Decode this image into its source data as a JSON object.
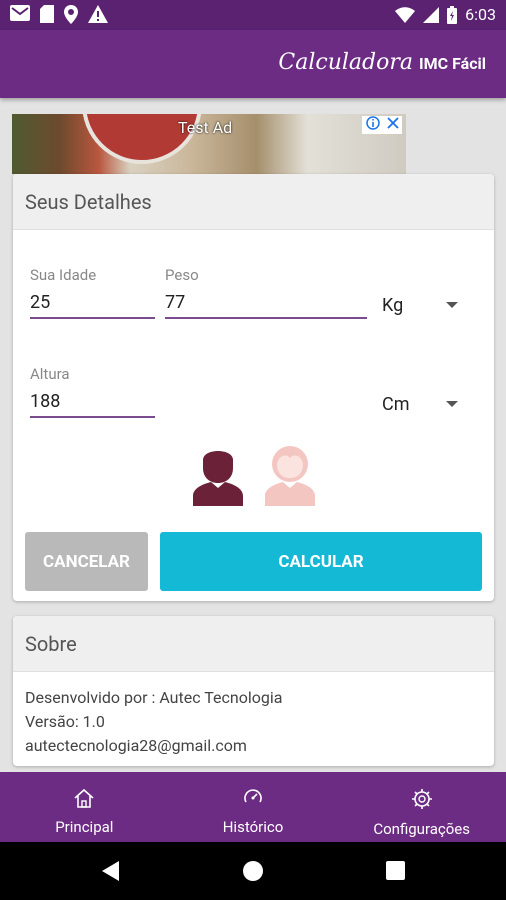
{
  "status_bar": {
    "time": "6:03",
    "left_icons": [
      "gmail-icon",
      "sd-card-icon",
      "location-icon",
      "warning-icon"
    ],
    "right_icons": [
      "wifi-icon",
      "signal-icon",
      "battery-icon"
    ]
  },
  "app_bar": {
    "title_script": "Calculadora",
    "title_plain": "IMC Fácil",
    "background": "#6c2c84"
  },
  "ad": {
    "label": "Test Ad",
    "adchoices_icons": [
      "info-icon",
      "close-icon"
    ]
  },
  "details": {
    "header": "Seus Detalhes",
    "age": {
      "label": "Sua Idade",
      "value": "25"
    },
    "weight": {
      "label": "Peso",
      "value": "77",
      "unit": "Kg"
    },
    "height": {
      "label": "Altura",
      "value": "188",
      "unit": "Cm"
    },
    "gender": {
      "male_color": "#6b2238",
      "female_color": "#f4c6c2",
      "selected": "male"
    },
    "buttons": {
      "cancel": "CANCELAR",
      "calculate": "CALCULAR"
    },
    "colors": {
      "cancel": "#b9b9b9",
      "calculate": "#14b9d6",
      "underline": "#7a4b8f"
    }
  },
  "about": {
    "header": "Sobre",
    "developer": "Desenvolvido por : Autec Tecnologia",
    "version": "Versão: 1.0",
    "email": "autectecnologia28@gmail.com"
  },
  "bottom_nav": {
    "items": [
      {
        "label": "Principal",
        "icon": "home-icon"
      },
      {
        "label": "Histórico",
        "icon": "history-icon"
      },
      {
        "label": "Configurações",
        "icon": "settings-icon"
      }
    ]
  }
}
